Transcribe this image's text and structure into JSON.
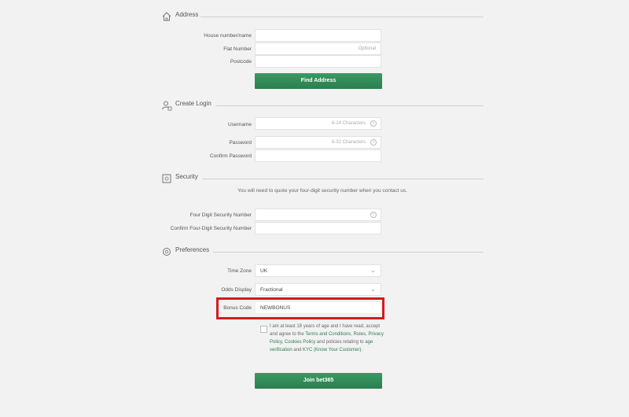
{
  "address": {
    "title": "Address",
    "labels": [
      "House number/name",
      "Flat Number",
      "Postcode"
    ],
    "flat_hint": "Optional",
    "find_button": "Find Address"
  },
  "login": {
    "title": "Create Login",
    "labels": [
      "Username",
      "Password",
      "Confirm Password"
    ],
    "username_hint": "6-14 Characters",
    "password_hint": "6-32 Characters"
  },
  "security": {
    "title": "Security",
    "note": "You will need to quote your four-digit security number when you contact us.",
    "labels": [
      "Four Digit Security Number",
      "Confirm Four-Digit Security Number"
    ]
  },
  "preferences": {
    "title": "Preferences",
    "labels": [
      "Time Zone",
      "Odds Display",
      "Bonus Code"
    ],
    "time_zone": "UK",
    "odds_display": "Fractional",
    "bonus_code": "NEWBONUS"
  },
  "terms": {
    "prefix": "I am at least 18 years of age and I have read, accept and agree to the ",
    "terms_link": "Terms and Conditions",
    "sep1": ", ",
    "rules_link": "Rules",
    "sep2": ", ",
    "privacy_link": "Privacy Policy",
    "sep3": ", ",
    "cookies_link": "Cookies Policy",
    "mid": " and policies relating to ",
    "age_link": "age verification",
    "and": " and ",
    "kyc_link": "KYC (Know Your Customer)",
    "end": "."
  },
  "join_button": "Join bet365",
  "icons": {
    "address": "house-icon",
    "login": "user-lock-icon",
    "security": "safe-icon",
    "preferences": "gear-icon",
    "info": "info-icon",
    "dropdown": "chevron-down-icon"
  },
  "colors": {
    "button": "#2b7e4f",
    "highlight": "#d31b22",
    "link": "#2b7e4f"
  }
}
